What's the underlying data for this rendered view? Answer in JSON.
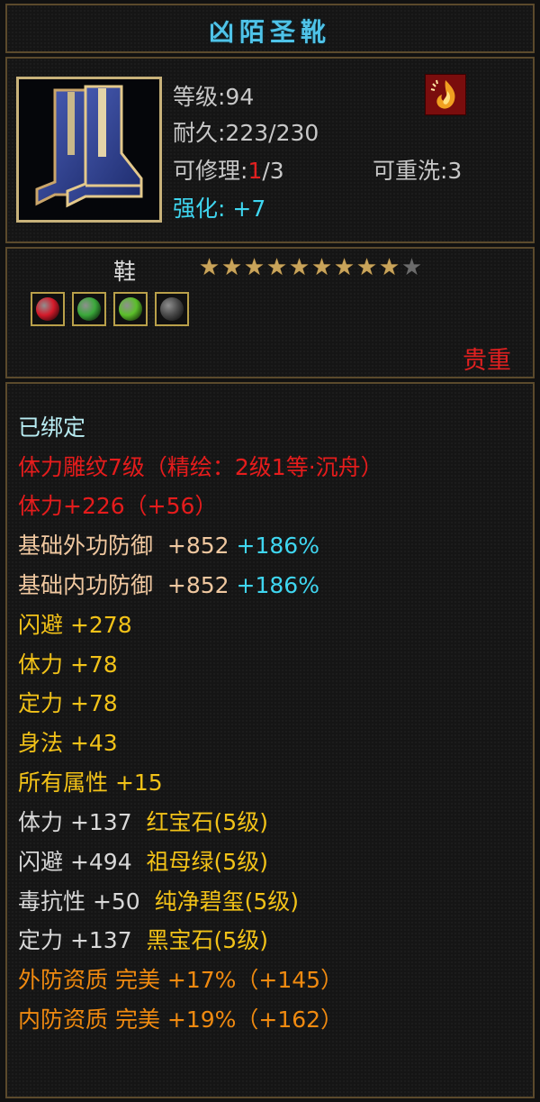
{
  "item": {
    "name": "凶陌圣靴",
    "level": "等级:94",
    "durability": "耐久:223/230",
    "repair_prefix": "可修理:",
    "repair_used": "1",
    "repair_total": "/3",
    "rewash": "可重洗:3",
    "enhance_label": "强化:",
    "enhance_value": "+7",
    "type": "鞋",
    "stars_total": 10,
    "stars_filled": 9,
    "rarity": "贵重",
    "gems": [
      {
        "name": "red-gem-icon",
        "color": "#d41a2a"
      },
      {
        "name": "green-gem-icon",
        "color": "#3aa83a"
      },
      {
        "name": "green-gem-icon",
        "color": "#5bbf2a"
      },
      {
        "name": "black-gem-icon",
        "color": "#4a4a4a"
      }
    ]
  },
  "attributes": [
    {
      "text": "已绑定",
      "color": "#b8ecf2"
    },
    {
      "text": "体力雕纹7级（精绘：2级1等·沉舟）",
      "color": "#e51c1c"
    },
    {
      "text": "体力+226（+56）",
      "color": "#e51c1c"
    },
    {
      "text": "基础外功防御",
      "value": "+852",
      "extra": "+186%",
      "color": "#f0c8a0"
    },
    {
      "text": "基础内功防御",
      "value": "+852",
      "extra": "+186%",
      "color": "#f0c8a0"
    },
    {
      "text": "闪避 +278",
      "color": "#f2c218"
    },
    {
      "text": "体力 +78",
      "color": "#f2c218"
    },
    {
      "text": "定力 +78",
      "color": "#f2c218"
    },
    {
      "text": "身法 +43",
      "color": "#f2c218"
    },
    {
      "text": "所有属性 +15",
      "color": "#f2c218"
    },
    {
      "text": "体力 +137",
      "gem": "红宝石(5级)",
      "color": "#d8d8d8"
    },
    {
      "text": "闪避 +494",
      "gem": "祖母绿(5级)",
      "color": "#d8d8d8"
    },
    {
      "text": "毒抗性 +50",
      "gem": "纯净碧玺(5级)",
      "color": "#d8d8d8"
    },
    {
      "text": "定力 +137",
      "gem": "黑宝石(5级)",
      "color": "#d8d8d8"
    },
    {
      "text": "外防资质  完美 +17%（+145）",
      "color": "#f08a10"
    },
    {
      "text": "内防资质  完美 +19%（+162）",
      "color": "#f08a10"
    }
  ],
  "colors": {
    "title": "#4fc3e8",
    "border": "#5b4a2c",
    "enhance": "#3fd6f0",
    "gem_label": "#f2c218",
    "defense_bonus": "#3fd6f0"
  }
}
